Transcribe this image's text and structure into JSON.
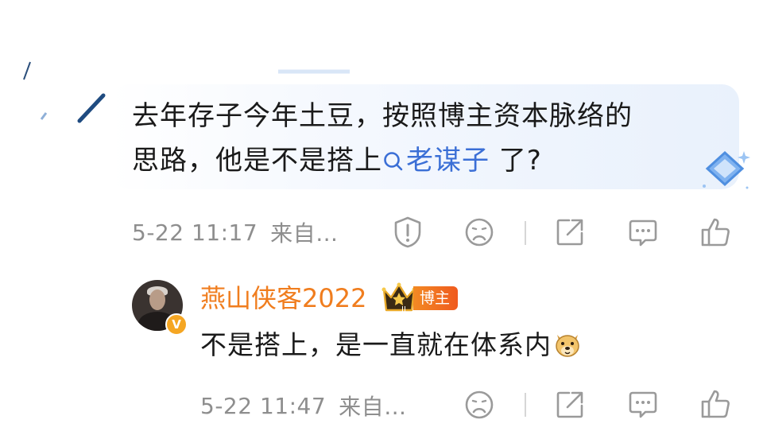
{
  "comment": {
    "text_line1": "去年存子今年土豆，按照博主资本脉络的",
    "text_line2_prefix": "思路，他是不是搭上",
    "topic_link": "老谋子",
    "text_line2_suffix": " 了?",
    "time": "5-22 11:17",
    "source": "来自…",
    "actions": [
      "report-icon",
      "dislike-icon",
      "share-icon",
      "comment-icon",
      "like-icon"
    ]
  },
  "reply": {
    "username": "燕山侠客2022",
    "level_badge": "II",
    "role_tag": "博主",
    "verified_mark": "V",
    "text": "不是搭上，是一直就在体系内",
    "emoji": "doge-emoji",
    "time": "5-22 11:47",
    "source": "来自…",
    "actions": [
      "dislike-icon",
      "share-icon",
      "comment-icon",
      "like-icon"
    ]
  },
  "colors": {
    "username": "#f07d1e",
    "link": "#3b6fd6",
    "meta": "#8e8e8e",
    "icon": "#9a9a9a"
  }
}
